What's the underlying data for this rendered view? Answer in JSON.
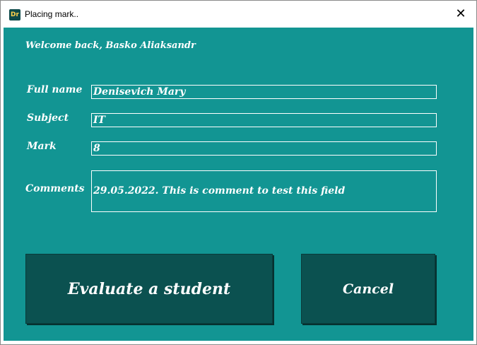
{
  "window": {
    "title": "Placing mark..",
    "icon": "app-icon",
    "icon_text": "Dr",
    "close_glyph": "✕"
  },
  "colors": {
    "background": "#129593",
    "button": "#0b5150",
    "text": "#ffffff"
  },
  "welcome": "Welcome back, Basko Aliaksandr",
  "form": {
    "full_name_label": "Full name",
    "full_name_value": "Denisevich Mary",
    "subject_label": "Subject",
    "subject_value": "IT",
    "mark_label": "Mark",
    "mark_value": "8",
    "comments_label": "Comments",
    "comments_value": "29.05.2022. This is comment to test this field"
  },
  "buttons": {
    "evaluate": "Evaluate a student",
    "cancel": "Cancel"
  }
}
